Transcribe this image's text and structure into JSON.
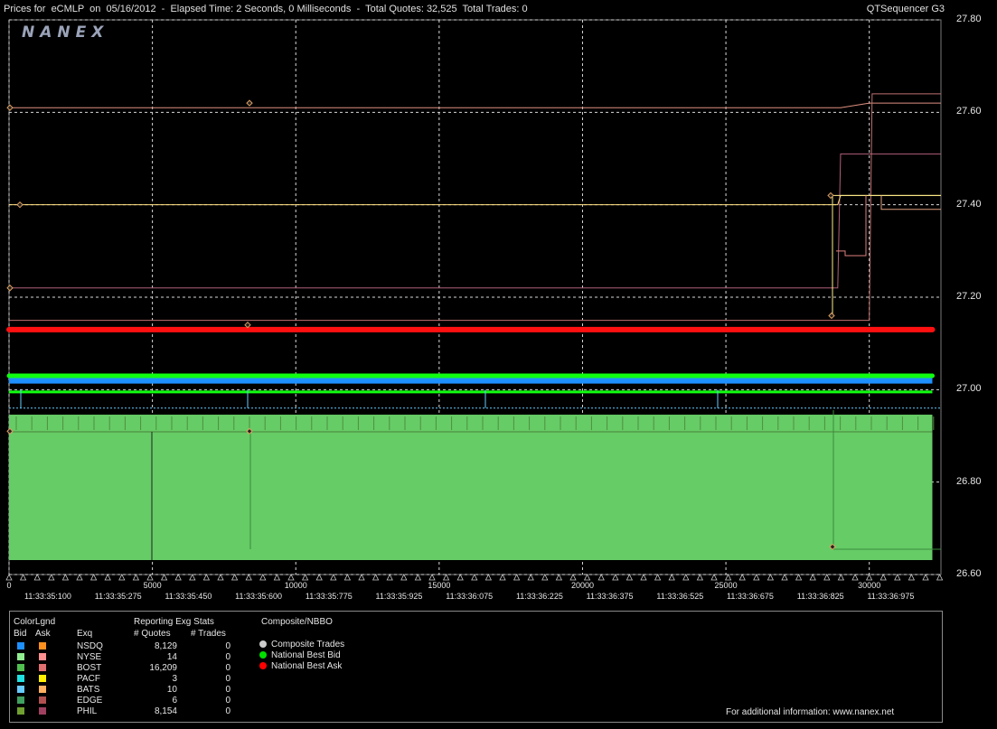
{
  "header": {
    "title": "Prices for  eCMLP  on  05/16/2012  -  Elapsed Time: 2 Seconds, 0 Milliseconds  -  Total Quotes: 32,525  Total Trades: 0",
    "app_name": "QTSequencer G3"
  },
  "logo": "NANEX",
  "chart_data": {
    "type": "line",
    "ylim": [
      26.6,
      27.8
    ],
    "xlim": [
      0,
      32500
    ],
    "yticks": [
      "27.80",
      "27.60",
      "27.40",
      "27.20",
      "27.00",
      "26.80",
      "26.60"
    ],
    "xticks": [
      "0",
      "5000",
      "10000",
      "15000",
      "20000",
      "25000",
      "30000"
    ],
    "xtimes": [
      "11:33:35:100",
      "11:33:35:275",
      "11:33:35:450",
      "11:33:35:600",
      "11:33:35:775",
      "11:33:35:925",
      "11:33:36:075",
      "11:33:36:225",
      "11:33:36:375",
      "11:33:36:525",
      "11:33:36:675",
      "11:33:36:825",
      "11:33:36:975"
    ],
    "grid": true,
    "series": [
      {
        "name": "National Best Ask",
        "color": "#ff1010",
        "x": [
          0,
          32200
        ],
        "y": [
          27.13,
          27.13
        ]
      },
      {
        "name": "National Best Bid",
        "color": "#10ff10",
        "x": [
          0,
          32200
        ],
        "y": [
          27.03,
          27.03
        ]
      },
      {
        "name": "NSDQ Bid",
        "color": "#1e90ff",
        "x": [
          0,
          32200
        ],
        "y": [
          27.02,
          27.02
        ]
      },
      {
        "name": "BOST Bid",
        "color": "#66cc66",
        "x": [
          0,
          32200
        ],
        "y": [
          26.94,
          26.94
        ]
      },
      {
        "name": "PHIL Ask",
        "color": "#b0607a",
        "x": [
          0,
          28900,
          29000,
          32500
        ],
        "y": [
          27.22,
          27.22,
          27.51,
          27.51
        ]
      },
      {
        "name": "NYSE Ask",
        "color": "#e09080",
        "x": [
          0,
          29000,
          30000,
          32500
        ],
        "y": [
          27.61,
          27.61,
          27.62,
          27.62
        ]
      },
      {
        "name": "PACF Ask",
        "color": "#ffe080",
        "x": [
          0,
          28900,
          29000,
          32500
        ],
        "y": [
          27.4,
          27.4,
          27.42,
          27.42
        ]
      },
      {
        "name": "EDGE Ask",
        "color": "#c07070",
        "x": [
          0,
          30000,
          30100,
          32500
        ],
        "y": [
          27.15,
          27.15,
          27.64,
          27.64
        ]
      }
    ]
  },
  "legend": {
    "color_legend_title": "ColorLgnd",
    "bid_header": "Bid",
    "ask_header": "Ask",
    "exq_header": "Exq",
    "stats_title": "Reporting Exg Stats",
    "quotes_header": "# Quotes",
    "trades_header": "# Trades",
    "composite_title": "Composite/NBBO",
    "rows": [
      {
        "exq": "NSDQ",
        "quotes": "8,129",
        "trades": "0",
        "bid_color": "#1e90ff",
        "ask_color": "#ff9020"
      },
      {
        "exq": "NYSE",
        "quotes": "14",
        "trades": "0",
        "bid_color": "#90ee90",
        "ask_color": "#ff9090"
      },
      {
        "exq": "BOST",
        "quotes": "16,209",
        "trades": "0",
        "bid_color": "#50c050",
        "ask_color": "#e07070"
      },
      {
        "exq": "PACF",
        "quotes": "3",
        "trades": "0",
        "bid_color": "#20e0e0",
        "ask_color": "#ffee00"
      },
      {
        "exq": "BATS",
        "quotes": "10",
        "trades": "0",
        "bid_color": "#66ccff",
        "ask_color": "#ffb060"
      },
      {
        "exq": "EDGE",
        "quotes": "6",
        "trades": "0",
        "bid_color": "#40a060",
        "ask_color": "#b05050"
      },
      {
        "exq": "PHIL",
        "quotes": "8,154",
        "trades": "0",
        "bid_color": "#70a030",
        "ask_color": "#a04060"
      }
    ],
    "composite_items": [
      {
        "label": "Composite Trades",
        "color": "#cccccc"
      },
      {
        "label": "National Best Bid",
        "color": "#00e000"
      },
      {
        "label": "National Best Ask",
        "color": "#ff0000"
      }
    ],
    "footer": "For additional information: www.nanex.net"
  }
}
